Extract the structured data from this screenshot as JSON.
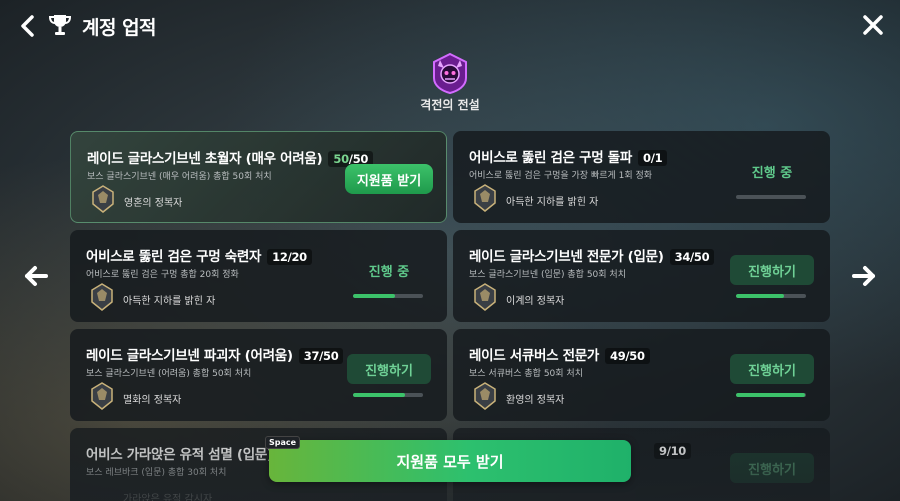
{
  "header": {
    "title": "계정 업적"
  },
  "category": {
    "name": "격전의 전설"
  },
  "claim_all": {
    "label": "지원품 모두 받기",
    "key_hint": "Space"
  },
  "cards": [
    {
      "title": "레이드 글라스기브넨 초월자 (매우 어려움)",
      "current": "50",
      "total": "/50",
      "desc": "보스 글라스기브넨 (매우 어려움) 총합 50회 처치",
      "reward": "영혼의 정복자",
      "state": "claim",
      "action_label": "지원품 받기",
      "progress": 1.0
    },
    {
      "title": "어비스로 뚫린 검은 구멍 돌파",
      "current": "0",
      "total": "/1",
      "desc": "어비스로 뚫린 검은 구멍을 가장 빠르게 1회 정화",
      "reward": "아득한 지하를 밝힌 자",
      "state": "in_progress",
      "action_label": "진행 중",
      "progress": 0.0
    },
    {
      "title": "어비스로 뚫린 검은 구멍 숙련자",
      "current": "12",
      "total": "/20",
      "desc": "어비스로 뚫린 검은 구멍 총합 20회 정화",
      "reward": "아득한 지하를 밝힌 자",
      "state": "in_progress",
      "action_label": "진행 중",
      "progress": 0.6
    },
    {
      "title": "레이드 글라스기브넨 전문가 (입문)",
      "current": "34",
      "total": "/50",
      "desc": "보스 글라스기브넨 (입문) 총합 50회 처치",
      "reward": "이계의 정복자",
      "state": "go",
      "action_label": "진행하기",
      "progress": 0.68
    },
    {
      "title": "레이드 글라스기브넨 파괴자 (어려움)",
      "current": "37",
      "total": "/50",
      "desc": "보스 글라스기브넨 (어려움) 총합 50회 처치",
      "reward": "멸화의 정복자",
      "state": "go",
      "action_label": "진행하기",
      "progress": 0.74
    },
    {
      "title": "레이드 서큐버스 전문가",
      "current": "49",
      "total": "/50",
      "desc": "보스 서큐버스 총합 50회 처치",
      "reward": "환영의 정복자",
      "state": "go",
      "action_label": "진행하기",
      "progress": 0.98
    },
    {
      "title": "어비스 가라앉은 유적 섬멸 (입문)",
      "current": "",
      "total": "",
      "desc": "보스 레브바크 (입문) 총합 30회 처치",
      "reward": "가라앉은 유적 감시자",
      "state": "none",
      "action_label": "",
      "progress": null
    },
    {
      "title": "",
      "current": "9",
      "total": "/10",
      "desc": "",
      "reward": "",
      "state": "go",
      "action_label": "진행하기",
      "progress": null
    }
  ],
  "colors": {
    "accent_green": "#3cc26a",
    "progress_green_text": "#5fc98b",
    "card_bg": "#161a1e"
  },
  "icons": [
    "back-arrow-icon",
    "trophy-icon",
    "close-icon",
    "demon-emblem-icon",
    "left-arrow-icon",
    "right-arrow-icon",
    "badge-icon"
  ]
}
